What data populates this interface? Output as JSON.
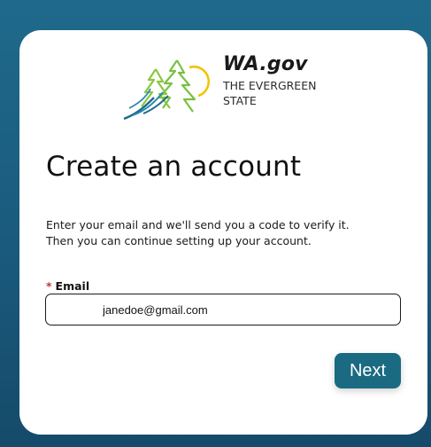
{
  "logo": {
    "name": "WA.gov",
    "tagline_line1": "THE EVERGREEN",
    "tagline_line2": "STATE",
    "icon": "evergreen-trees-sun-logo"
  },
  "form": {
    "title": "Create an account",
    "description_line1": "Enter your email and we'll send you a code to verify it.",
    "description_line2": "Then you can continue setting up your account.",
    "email": {
      "required_marker": "*",
      "label": "Email",
      "value": "janedoe@gmail.com"
    },
    "next_label": "Next"
  },
  "colors": {
    "background": "#1f6a8c",
    "button": "#1a6a82",
    "required": "#c0392b",
    "logo_green": "#7ac142",
    "logo_blue": "#1f6a8c",
    "logo_yellow": "#f2c200"
  }
}
